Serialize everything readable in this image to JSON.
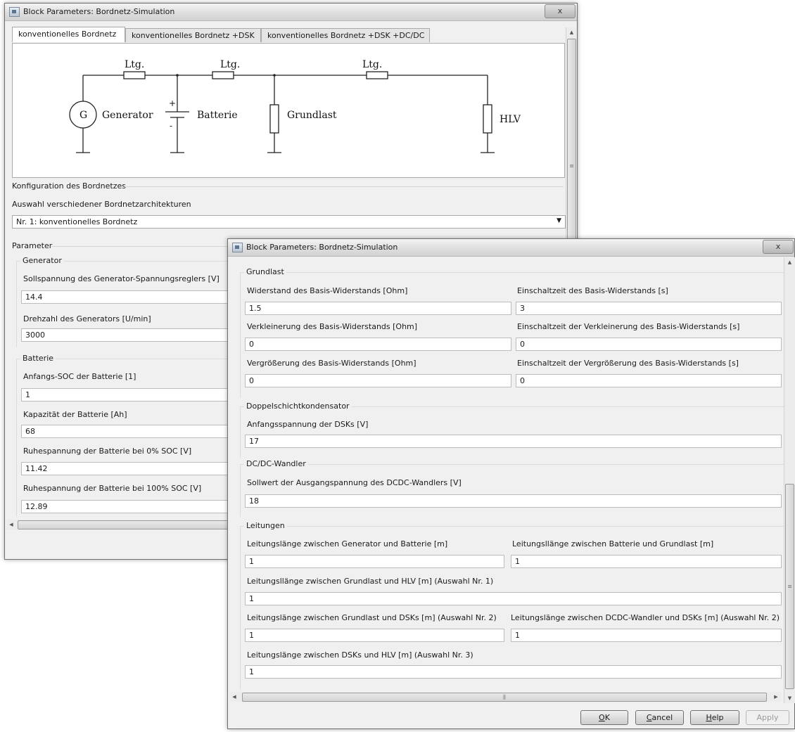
{
  "window1": {
    "title": "Block Parameters: Bordnetz-Simulation",
    "close": "x",
    "tabs": [
      {
        "label": "konventionelles Bordnetz"
      },
      {
        "label": "konventionelles Bordnetz +DSK"
      },
      {
        "label": "konventionelles Bordnetz +DSK +DC/DC"
      }
    ],
    "diagram": {
      "ltg": "Ltg.",
      "generator_symbol": "G",
      "generator": "Generator",
      "plus": "+",
      "minus": "-",
      "batterie": "Batterie",
      "grundlast": "Grundlast",
      "hlv": "HLV"
    },
    "config": {
      "group": "Konfiguration des Bordnetzes",
      "label": "Auswahl verschiedener Bordnetzarchitekturen",
      "selected": "Nr. 1: konventionelles Bordnetz"
    },
    "parameter": {
      "group": "Parameter",
      "generator": {
        "group": "Generator",
        "soll_label": "Sollspannung des Generator-Spannungsreglers [V]",
        "soll_value": "14.4",
        "drehzahl_label": "Drehzahl des Generators [U/min]",
        "drehzahl_value": "3000"
      },
      "batterie": {
        "group": "Batterie",
        "soc_label": "Anfangs-SOC der Batterie [1]",
        "soc_value": "1",
        "kap_label": "Kapazität der Batterie [Ah]",
        "kap_value": "68",
        "ruhe0_label": "Ruhespannung der Batterie bei 0% SOC [V]",
        "ruhe0_value": "11.42",
        "ruhe100_label": "Ruhespannung der Batterie  bei 100% SOC [V]",
        "ruhe100_value": "12.89"
      }
    }
  },
  "window2": {
    "title": "Block Parameters: Bordnetz-Simulation",
    "close": "x",
    "grundlast": {
      "group": "Grundlast",
      "widerstand_label": "Widerstand des Basis-Widerstands [Ohm]",
      "widerstand_value": "1.5",
      "einschalt_label": "Einschaltzeit des Basis-Widerstands [s]",
      "einschalt_value": "3",
      "verkl_label": "Verkleinerung des Basis-Widerstands [Ohm]",
      "verkl_value": "0",
      "einschalt_verkl_label": "Einschaltzeit der Verkleinerung des Basis-Widerstands [s]",
      "einschalt_verkl_value": "0",
      "vergr_label": "Vergrößerung des Basis-Widerstands [Ohm]",
      "vergr_value": "0",
      "einschalt_vergr_label": "Einschaltzeit der Vergrößerung des Basis-Widerstands [s]",
      "einschalt_vergr_value": "0"
    },
    "dsk": {
      "group": "Doppelschichtkondensator",
      "anfang_label": "Anfangsspannung der DSKs [V]",
      "anfang_value": "17"
    },
    "dcdc": {
      "group": "DC/DC-Wandler",
      "soll_label": "Sollwert der Ausgangspannung des DCDC-Wandlers [V]",
      "soll_value": "18"
    },
    "leitungen": {
      "group": "Leitungen",
      "gen_bat_label": "Leitungslänge zwischen Generator und Batterie [m]",
      "gen_bat_value": "1",
      "bat_grund_label": "Leitungsllänge zwischen Batterie und Grundlast [m]",
      "bat_grund_value": "1",
      "grund_hlv_label": "Leitungsllänge zwischen Grundlast und HLV [m] (Auswahl Nr. 1)",
      "grund_hlv_value": "1",
      "grund_dsk_label": "Leitungslänge zwischen Grundlast und DSKs [m] (Auswahl Nr. 2)",
      "grund_dsk_value": "1",
      "dcdc_dsk_label": "Leitungslänge zwischen DCDC-Wandler und DSKs [m] (Auswahl Nr. 2)",
      "dcdc_dsk_value": "1",
      "dsk_hlv_label": "Leitungslänge zwischen DSKs und HLV [m] (Auswahl Nr. 3)",
      "dsk_hlv_value": "1"
    },
    "buttons": {
      "ok_prefix": "",
      "ok_u": "O",
      "ok_rest": "K",
      "cancel_u": "C",
      "cancel_rest": "ancel",
      "help_u": "H",
      "help_rest": "elp",
      "apply": "Apply"
    }
  },
  "colors": {
    "window_bg": "#f0f0f0",
    "field_border": "#bcbcbc",
    "title_gradient": "#dcdcdc"
  }
}
